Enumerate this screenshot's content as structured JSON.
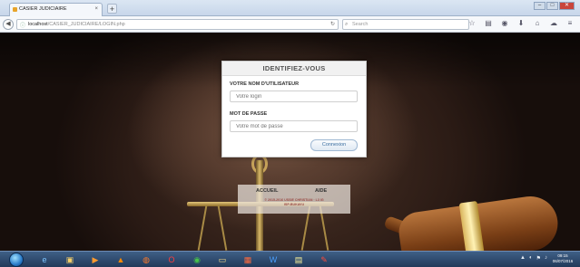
{
  "browser": {
    "tab_title": "CASIER JUDICIAIRE",
    "tab_close": "×",
    "new_tab": "+",
    "url_host": "localhost",
    "url_path": "/CASIER_JUDICIAIRE/LOGIN.php",
    "search_placeholder": "Search",
    "reload_glyph": "↻",
    "window_controls": [
      "–",
      "□",
      "✕"
    ]
  },
  "login": {
    "title": "IDENTIFIEZ-VOUS",
    "username_label": "VOTRE NOM D'UTILISATEUR",
    "username_placeholder": "Votre login",
    "password_label": "MOT DE PASSE",
    "password_placeholder": "Votre mot de passe",
    "submit_label": "Connexion"
  },
  "footer": {
    "links": [
      "ACCUEIL",
      "AIDE"
    ],
    "copyright": "© 2015-2016 USSIE CHRISTIAN · L3 IG",
    "credit": "ISP-BUKAVU"
  },
  "taskbar": {
    "clock_time": "09:15",
    "clock_date": "06/07/2016",
    "apps": [
      "ie",
      "explorer",
      "media",
      "vlc",
      "firefox",
      "opera",
      "chrome",
      "folder",
      "powerpoint",
      "word",
      "notes",
      "pdf"
    ]
  },
  "colors": {
    "card_border": "#c9c9c9",
    "button_text": "#3b6ea0",
    "copyright_text": "#9b4b46"
  }
}
